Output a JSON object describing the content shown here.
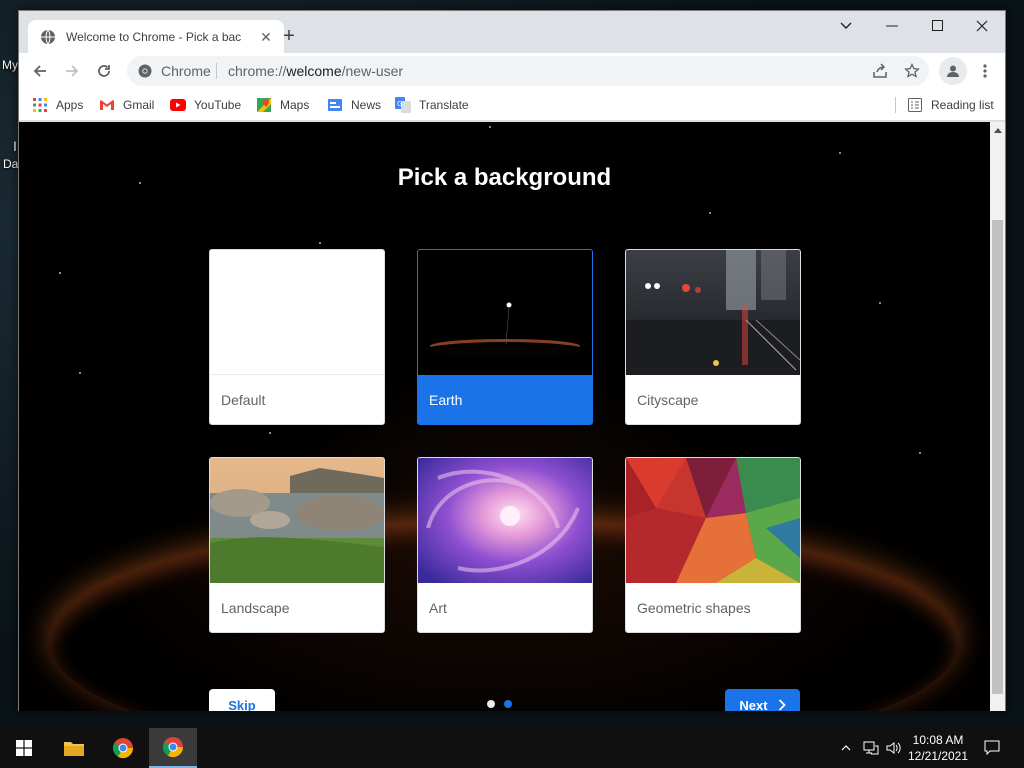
{
  "desktop": {
    "icon_label_1": "My",
    "icon_label_2": "Da"
  },
  "browser": {
    "tab_title": "Welcome to Chrome - Pick a bac",
    "omnibox_chip": "Chrome",
    "url_scheme": "chrome://",
    "url_host": "welcome",
    "url_path": "/new-user"
  },
  "bookmarks": {
    "items": [
      {
        "label": "Apps",
        "icon": "apps-grid-icon"
      },
      {
        "label": "Gmail",
        "icon": "gmail-icon"
      },
      {
        "label": "YouTube",
        "icon": "youtube-icon"
      },
      {
        "label": "Maps",
        "icon": "maps-icon"
      },
      {
        "label": "News",
        "icon": "news-icon"
      },
      {
        "label": "Translate",
        "icon": "translate-icon"
      }
    ],
    "reading_list": "Reading list"
  },
  "page": {
    "title": "Pick a background",
    "cards": [
      {
        "label": "Default",
        "selected": false
      },
      {
        "label": "Earth",
        "selected": true
      },
      {
        "label": "Cityscape",
        "selected": false
      },
      {
        "label": "Landscape",
        "selected": false
      },
      {
        "label": "Art",
        "selected": false
      },
      {
        "label": "Geometric shapes",
        "selected": false
      }
    ],
    "skip_label": "Skip",
    "next_label": "Next",
    "steps_total": 2,
    "step_current": 2
  },
  "taskbar": {
    "time": "10:08 AM",
    "date": "12/21/2021"
  },
  "colors": {
    "accent": "#1a73e8",
    "tab_strip": "#dee1e6",
    "page_background": "#000000"
  }
}
